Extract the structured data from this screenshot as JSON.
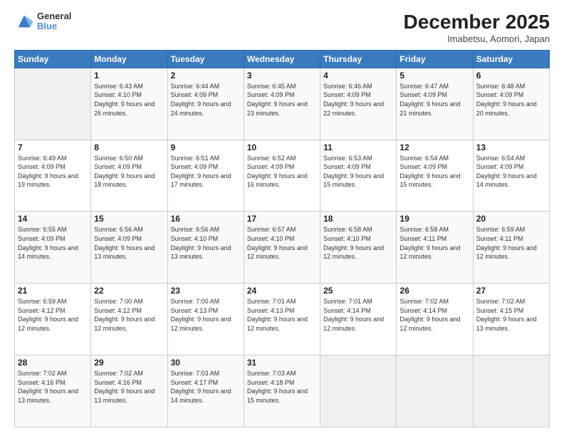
{
  "header": {
    "logo": {
      "general": "General",
      "blue": "Blue"
    },
    "title": "December 2025",
    "subtitle": "Imabetsu, Aomori, Japan"
  },
  "weekdays": [
    "Sunday",
    "Monday",
    "Tuesday",
    "Wednesday",
    "Thursday",
    "Friday",
    "Saturday"
  ],
  "weeks": [
    [
      {
        "day": null
      },
      {
        "day": "1",
        "sunrise": "6:43 AM",
        "sunset": "4:10 PM",
        "daylight": "9 hours and 26 minutes."
      },
      {
        "day": "2",
        "sunrise": "6:44 AM",
        "sunset": "4:09 PM",
        "daylight": "9 hours and 24 minutes."
      },
      {
        "day": "3",
        "sunrise": "6:45 AM",
        "sunset": "4:09 PM",
        "daylight": "9 hours and 23 minutes."
      },
      {
        "day": "4",
        "sunrise": "6:46 AM",
        "sunset": "4:09 PM",
        "daylight": "9 hours and 22 minutes."
      },
      {
        "day": "5",
        "sunrise": "6:47 AM",
        "sunset": "4:09 PM",
        "daylight": "9 hours and 21 minutes."
      },
      {
        "day": "6",
        "sunrise": "6:48 AM",
        "sunset": "4:09 PM",
        "daylight": "9 hours and 20 minutes."
      }
    ],
    [
      {
        "day": "7",
        "sunrise": "6:49 AM",
        "sunset": "4:09 PM",
        "daylight": "9 hours and 19 minutes."
      },
      {
        "day": "8",
        "sunrise": "6:50 AM",
        "sunset": "4:09 PM",
        "daylight": "9 hours and 18 minutes."
      },
      {
        "day": "9",
        "sunrise": "6:51 AM",
        "sunset": "4:09 PM",
        "daylight": "9 hours and 17 minutes."
      },
      {
        "day": "10",
        "sunrise": "6:52 AM",
        "sunset": "4:09 PM",
        "daylight": "9 hours and 16 minutes."
      },
      {
        "day": "11",
        "sunrise": "6:53 AM",
        "sunset": "4:09 PM",
        "daylight": "9 hours and 15 minutes."
      },
      {
        "day": "12",
        "sunrise": "6:54 AM",
        "sunset": "4:09 PM",
        "daylight": "9 hours and 15 minutes."
      },
      {
        "day": "13",
        "sunrise": "6:54 AM",
        "sunset": "4:09 PM",
        "daylight": "9 hours and 14 minutes."
      }
    ],
    [
      {
        "day": "14",
        "sunrise": "6:55 AM",
        "sunset": "4:09 PM",
        "daylight": "9 hours and 14 minutes."
      },
      {
        "day": "15",
        "sunrise": "6:56 AM",
        "sunset": "4:09 PM",
        "daylight": "9 hours and 13 minutes."
      },
      {
        "day": "16",
        "sunrise": "6:56 AM",
        "sunset": "4:10 PM",
        "daylight": "9 hours and 13 minutes."
      },
      {
        "day": "17",
        "sunrise": "6:57 AM",
        "sunset": "4:10 PM",
        "daylight": "9 hours and 12 minutes."
      },
      {
        "day": "18",
        "sunrise": "6:58 AM",
        "sunset": "4:10 PM",
        "daylight": "9 hours and 12 minutes."
      },
      {
        "day": "19",
        "sunrise": "6:58 AM",
        "sunset": "4:11 PM",
        "daylight": "9 hours and 12 minutes."
      },
      {
        "day": "20",
        "sunrise": "6:59 AM",
        "sunset": "4:11 PM",
        "daylight": "9 hours and 12 minutes."
      }
    ],
    [
      {
        "day": "21",
        "sunrise": "6:59 AM",
        "sunset": "4:12 PM",
        "daylight": "9 hours and 12 minutes."
      },
      {
        "day": "22",
        "sunrise": "7:00 AM",
        "sunset": "4:12 PM",
        "daylight": "9 hours and 12 minutes."
      },
      {
        "day": "23",
        "sunrise": "7:00 AM",
        "sunset": "4:13 PM",
        "daylight": "9 hours and 12 minutes."
      },
      {
        "day": "24",
        "sunrise": "7:01 AM",
        "sunset": "4:13 PM",
        "daylight": "9 hours and 12 minutes."
      },
      {
        "day": "25",
        "sunrise": "7:01 AM",
        "sunset": "4:14 PM",
        "daylight": "9 hours and 12 minutes."
      },
      {
        "day": "26",
        "sunrise": "7:02 AM",
        "sunset": "4:14 PM",
        "daylight": "9 hours and 12 minutes."
      },
      {
        "day": "27",
        "sunrise": "7:02 AM",
        "sunset": "4:15 PM",
        "daylight": "9 hours and 13 minutes."
      }
    ],
    [
      {
        "day": "28",
        "sunrise": "7:02 AM",
        "sunset": "4:16 PM",
        "daylight": "9 hours and 13 minutes."
      },
      {
        "day": "29",
        "sunrise": "7:02 AM",
        "sunset": "4:16 PM",
        "daylight": "9 hours and 13 minutes."
      },
      {
        "day": "30",
        "sunrise": "7:03 AM",
        "sunset": "4:17 PM",
        "daylight": "9 hours and 14 minutes."
      },
      {
        "day": "31",
        "sunrise": "7:03 AM",
        "sunset": "4:18 PM",
        "daylight": "9 hours and 15 minutes."
      },
      {
        "day": null
      },
      {
        "day": null
      },
      {
        "day": null
      }
    ]
  ],
  "labels": {
    "sunrise_prefix": "Sunrise: ",
    "sunset_prefix": "Sunset: ",
    "daylight_prefix": "Daylight: "
  }
}
